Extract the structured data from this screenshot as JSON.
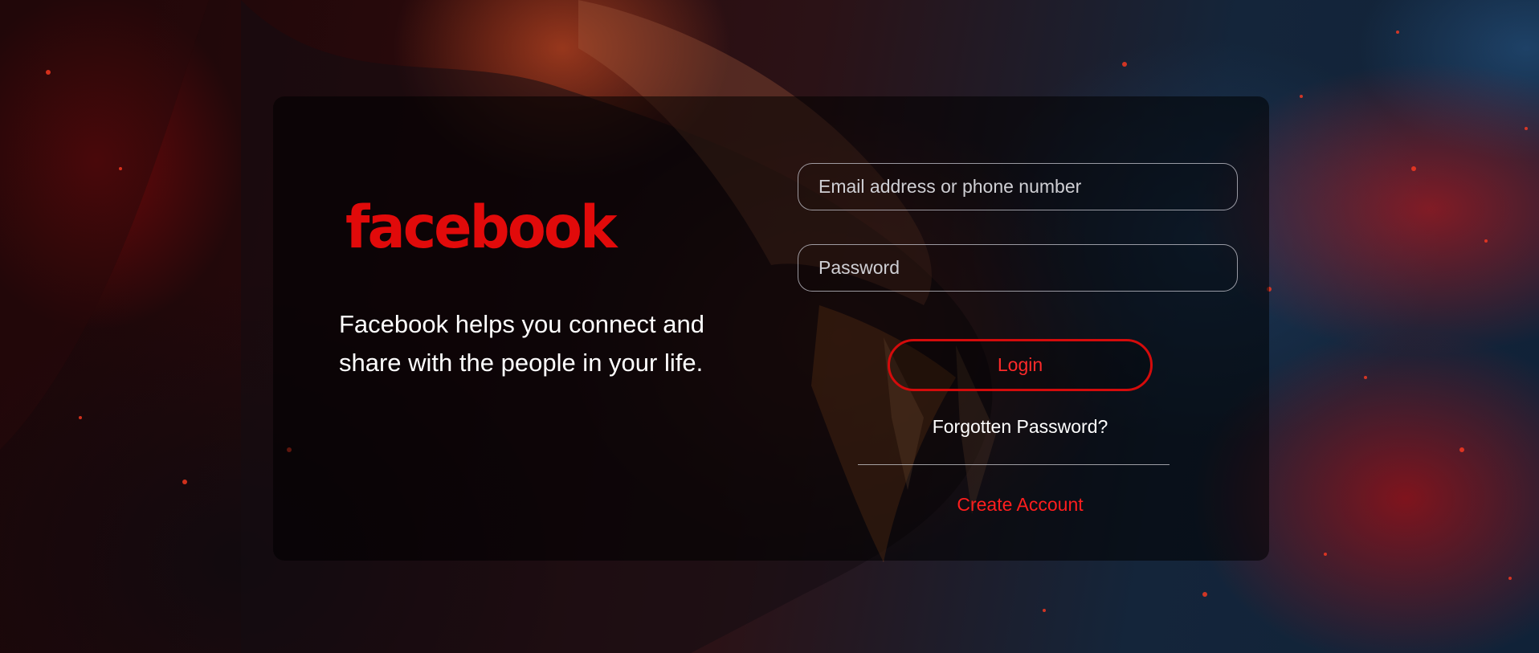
{
  "brand": {
    "logo_text": "facebook",
    "tagline": "Facebook helps you connect and share with the people in your life."
  },
  "login_form": {
    "email_placeholder": "Email address or phone number",
    "email_value": "",
    "password_placeholder": "Password",
    "password_value": "",
    "login_label": "Login",
    "forgot_label": "Forgotten Password?",
    "create_label": "Create Account"
  },
  "colors": {
    "brand_red": "#e10a0a",
    "button_border": "#d40b0b",
    "link_red": "#ff1e1e"
  },
  "background": {
    "image": "dragon-fire-illustration"
  }
}
